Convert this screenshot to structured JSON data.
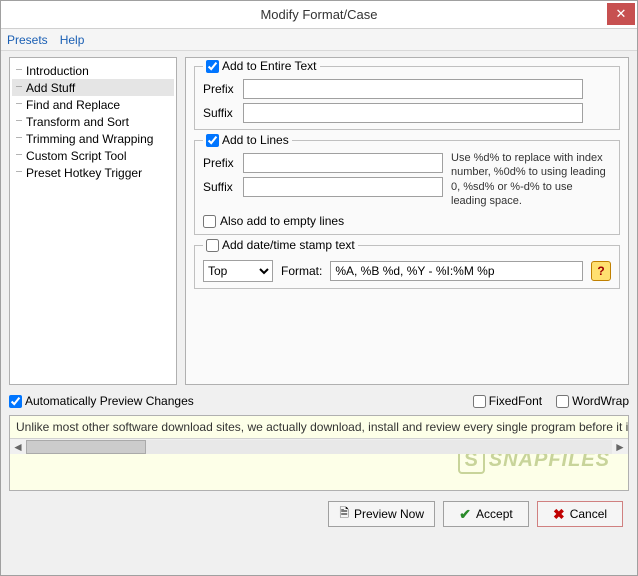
{
  "window": {
    "title": "Modify Format/Case"
  },
  "menu": {
    "presets": "Presets",
    "help": "Help"
  },
  "tree": {
    "items": [
      {
        "label": "Introduction"
      },
      {
        "label": "Add Stuff"
      },
      {
        "label": "Find and Replace"
      },
      {
        "label": "Transform and Sort"
      },
      {
        "label": "Trimming and Wrapping"
      },
      {
        "label": "Custom Script Tool"
      },
      {
        "label": "Preset Hotkey Trigger"
      }
    ],
    "selected_index": 1
  },
  "groups": {
    "entire": {
      "title": "Add to Entire Text",
      "prefix_label": "Prefix",
      "suffix_label": "Suffix",
      "prefix_value": "",
      "suffix_value": ""
    },
    "lines": {
      "title": "Add to Lines",
      "prefix_label": "Prefix",
      "suffix_label": "Suffix",
      "prefix_value": "",
      "suffix_value": "",
      "hint": "Use %d% to replace with index number, %0d% to using leading 0, %sd% or %-d% to use leading space.",
      "empty_label": "Also add to empty lines"
    },
    "date": {
      "title": "Add date/time stamp text",
      "position_value": "Top",
      "format_label": "Format:",
      "format_value": "%A, %B %d, %Y - %I:%M %p"
    }
  },
  "options": {
    "auto_preview": "Automatically Preview Changes",
    "fixed_font": "FixedFont",
    "word_wrap": "WordWrap"
  },
  "preview": {
    "text": "Unlike most other software download sites, we actually download, install and review every single program before it is listed on the sit",
    "watermark": "SNAPFILES"
  },
  "buttons": {
    "preview_now": "Preview Now",
    "accept": "Accept",
    "cancel": "Cancel"
  }
}
